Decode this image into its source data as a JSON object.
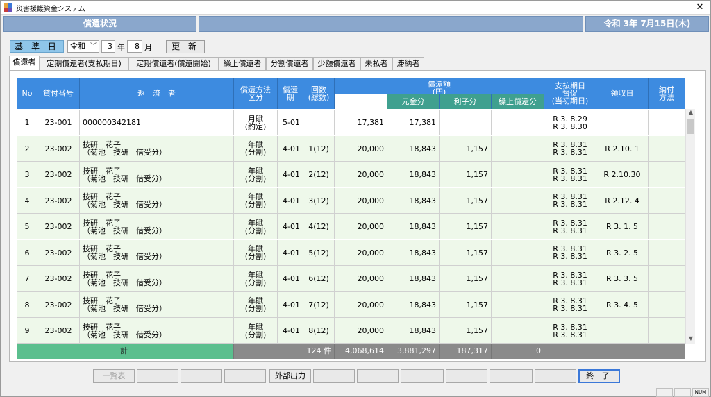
{
  "window": {
    "title": "災害援護資金システム",
    "close_glyph": "✕"
  },
  "header": {
    "title": "償還状況",
    "middle": "",
    "date": "令和 3年 7月15日(木)"
  },
  "filter": {
    "label": "基 準 日",
    "era": "令和",
    "year": "3",
    "year_unit": "年",
    "month": "8",
    "month_unit": "月",
    "update_label": "更 新"
  },
  "tabs": [
    "償還者",
    "定期償還者(支払期日)",
    "定期償還者(償還開始)",
    "繰上償還者",
    "分割償還者",
    "少額償還者",
    "未払者",
    "滞納者"
  ],
  "columns": {
    "no": "No",
    "loan_no": "貸付番号",
    "payer": "返　済　者",
    "method": [
      "償還方法",
      "区分"
    ],
    "period": [
      "償還",
      "期"
    ],
    "count": [
      "回数",
      "(総数)"
    ],
    "amount": [
      "償還額",
      "(円)"
    ],
    "principal": "元金分",
    "interest": "利子分",
    "prepay": "繰上償還分",
    "due": [
      "支払期日",
      "督促",
      "(当初期日)"
    ],
    "received": "領収日",
    "pay_method": [
      "納付",
      "方法"
    ]
  },
  "rows": [
    {
      "no": "1",
      "loan": "23-001",
      "payer": [
        "000000342181",
        ""
      ],
      "method": [
        "月賦",
        "(約定)"
      ],
      "period": "5-01",
      "count": "",
      "amount": "17,381",
      "principal": "17,381",
      "interest": "",
      "prepay": "",
      "due": [
        "R 3. 8.29",
        "R 3. 8.30"
      ],
      "received": "",
      "pay": ""
    },
    {
      "no": "2",
      "loan": "23-002",
      "payer": [
        "技研　花子",
        "（菊池　技研　借受分）"
      ],
      "method": [
        "年賦",
        "(分割)"
      ],
      "period": "4-01",
      "count": "1(12)",
      "amount": "20,000",
      "principal": "18,843",
      "interest": "1,157",
      "prepay": "",
      "due": [
        "R 3. 8.31",
        "R 3. 8.31"
      ],
      "received": "R 2.10. 1",
      "pay": ""
    },
    {
      "no": "3",
      "loan": "23-002",
      "payer": [
        "技研　花子",
        "（菊池　技研　借受分）"
      ],
      "method": [
        "年賦",
        "(分割)"
      ],
      "period": "4-01",
      "count": "2(12)",
      "amount": "20,000",
      "principal": "18,843",
      "interest": "1,157",
      "prepay": "",
      "due": [
        "R 3. 8.31",
        "R 3. 8.31"
      ],
      "received": "R 2.10.30",
      "pay": ""
    },
    {
      "no": "4",
      "loan": "23-002",
      "payer": [
        "技研　花子",
        "（菊池　技研　借受分）"
      ],
      "method": [
        "年賦",
        "(分割)"
      ],
      "period": "4-01",
      "count": "3(12)",
      "amount": "20,000",
      "principal": "18,843",
      "interest": "1,157",
      "prepay": "",
      "due": [
        "R 3. 8.31",
        "R 3. 8.31"
      ],
      "received": "R 2.12. 4",
      "pay": ""
    },
    {
      "no": "5",
      "loan": "23-002",
      "payer": [
        "技研　花子",
        "（菊池　技研　借受分）"
      ],
      "method": [
        "年賦",
        "(分割)"
      ],
      "period": "4-01",
      "count": "4(12)",
      "amount": "20,000",
      "principal": "18,843",
      "interest": "1,157",
      "prepay": "",
      "due": [
        "R 3. 8.31",
        "R 3. 8.31"
      ],
      "received": "R 3. 1. 5",
      "pay": ""
    },
    {
      "no": "6",
      "loan": "23-002",
      "payer": [
        "技研　花子",
        "（菊池　技研　借受分）"
      ],
      "method": [
        "年賦",
        "(分割)"
      ],
      "period": "4-01",
      "count": "5(12)",
      "amount": "20,000",
      "principal": "18,843",
      "interest": "1,157",
      "prepay": "",
      "due": [
        "R 3. 8.31",
        "R 3. 8.31"
      ],
      "received": "R 3. 2. 5",
      "pay": ""
    },
    {
      "no": "7",
      "loan": "23-002",
      "payer": [
        "技研　花子",
        "（菊池　技研　借受分）"
      ],
      "method": [
        "年賦",
        "(分割)"
      ],
      "period": "4-01",
      "count": "6(12)",
      "amount": "20,000",
      "principal": "18,843",
      "interest": "1,157",
      "prepay": "",
      "due": [
        "R 3. 8.31",
        "R 3. 8.31"
      ],
      "received": "R 3. 3. 5",
      "pay": ""
    },
    {
      "no": "8",
      "loan": "23-002",
      "payer": [
        "技研　花子",
        "（菊池　技研　借受分）"
      ],
      "method": [
        "年賦",
        "(分割)"
      ],
      "period": "4-01",
      "count": "7(12)",
      "amount": "20,000",
      "principal": "18,843",
      "interest": "1,157",
      "prepay": "",
      "due": [
        "R 3. 8.31",
        "R 3. 8.31"
      ],
      "received": "R 3. 4. 5",
      "pay": ""
    },
    {
      "no": "9",
      "loan": "23-002",
      "payer": [
        "技研　花子",
        "（菊池　技研　借受分）"
      ],
      "method": [
        "年賦",
        "(分割)"
      ],
      "period": "4-01",
      "count": "8(12)",
      "amount": "20,000",
      "principal": "18,843",
      "interest": "1,157",
      "prepay": "",
      "due": [
        "R 3. 8.31",
        "R 3. 8.31"
      ],
      "received": "",
      "pay": ""
    }
  ],
  "totals": {
    "label": "計",
    "count": "124 件",
    "amount": "4,068,614",
    "principal": "3,881,297",
    "interest": "187,317",
    "prepay": "0"
  },
  "footer": {
    "list_label": "一覧表",
    "export_label": "外部出力",
    "exit_label": "終 了"
  },
  "status": {
    "num": "NUM"
  },
  "colors": {
    "header": "#8aa7cc",
    "grid_header": "#3d8be0",
    "sub_header": "#3fa08f",
    "total_label": "#5bbf8e",
    "row_alt": "#eef8ea"
  }
}
